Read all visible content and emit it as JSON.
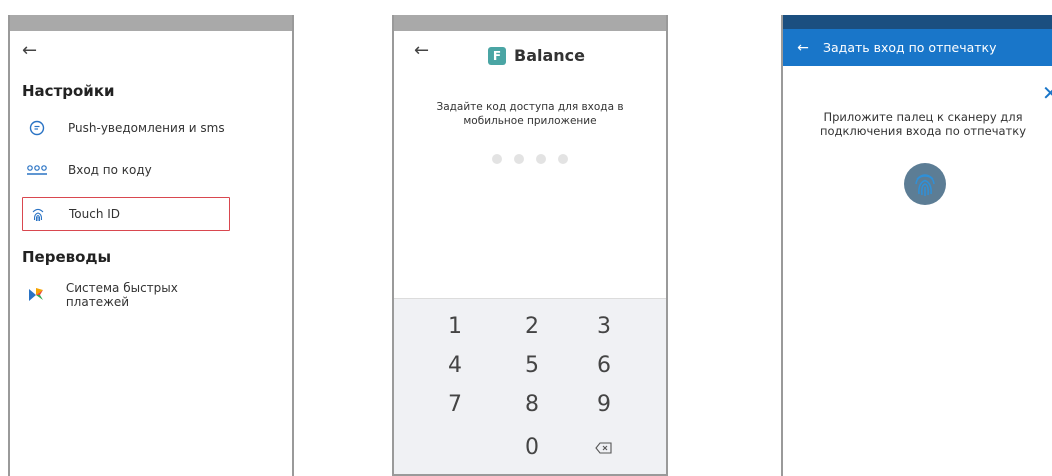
{
  "screen1": {
    "back_icon": "arrow-left-icon",
    "settings_title": "Настройки",
    "items": [
      {
        "label": "Push-уведомления и sms",
        "icon": "chat-bubble-icon"
      },
      {
        "label": "Вход по коду",
        "icon": "pin-dots-icon"
      },
      {
        "label": "Touch ID",
        "icon": "fingerprint-icon",
        "highlighted": true
      }
    ],
    "transfers_title": "Переводы",
    "transfer_items": [
      {
        "label": "Система быстрых платежей",
        "icon": "sbp-logo-icon"
      }
    ],
    "highlight_color": "#d9474f"
  },
  "screen2": {
    "back_icon": "arrow-left-icon",
    "logo_letter": "F",
    "app_name": "Balance",
    "brand_color": "#4aa5a4",
    "prompt": "Задайте код доступа для входа в мобильное приложение",
    "pin_length": 4,
    "keys": [
      "1",
      "2",
      "3",
      "4",
      "5",
      "6",
      "7",
      "8",
      "9",
      "0"
    ],
    "backspace_icon": "backspace-icon"
  },
  "screen3": {
    "back_icon": "arrow-left-icon",
    "title": "Задать вход по отпечатку",
    "close_icon": "close-icon",
    "hint": "Приложите палец к сканеру для подключения входа по отпечатку",
    "accent": "#1976c9",
    "fingerprint_icon": "fingerprint-icon"
  }
}
